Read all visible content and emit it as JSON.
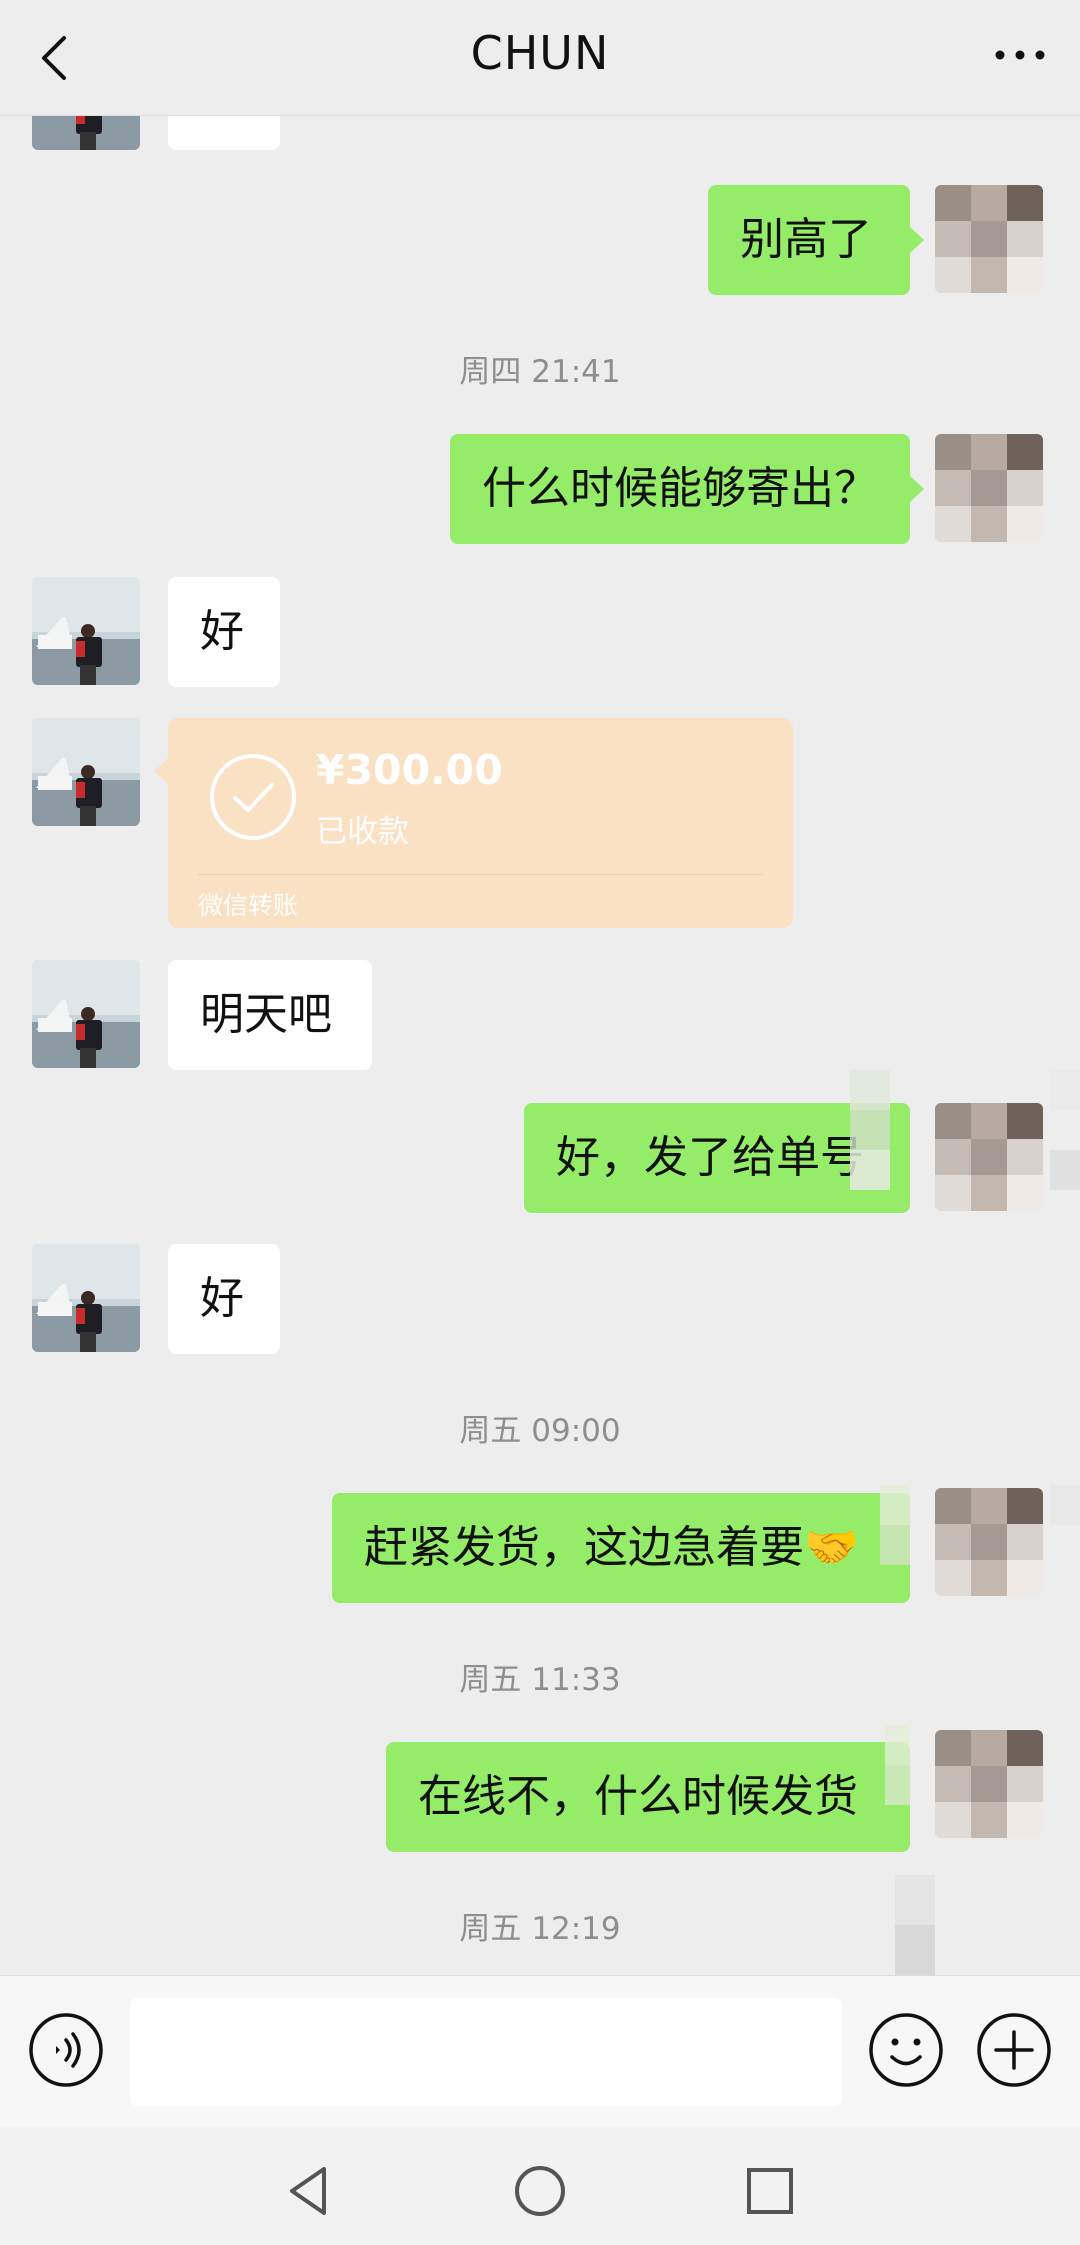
{
  "header": {
    "title": "CHUN",
    "back_icon": "chevron-left-icon",
    "more_icon": "more-dots-icon"
  },
  "messages": {
    "m1": {
      "text": "别高了"
    },
    "t1": "周四 21:41",
    "m2": {
      "text": "什么时候能够寄出？"
    },
    "m3": {
      "text": "好"
    },
    "transfer": {
      "amount": "¥300.00",
      "status": "已收款",
      "footer": "微信转账"
    },
    "m4": {
      "text": "明天吧"
    },
    "m5": {
      "text": "好，发了给单号"
    },
    "m6": {
      "text": "好"
    },
    "t2": "周五 09:00",
    "m7": {
      "text": "赶紧发货，这边急着要🤝"
    },
    "t3": "周五 11:33",
    "m8": {
      "text": "在线不，什么时候发货"
    },
    "t4": "周五 12:19"
  },
  "input_bar": {
    "voice_icon": "voice-icon",
    "emoji_icon": "emoji-icon",
    "plus_icon": "plus-icon"
  },
  "colors": {
    "background": "#ededed",
    "outgoing_bubble": "#95ec69",
    "incoming_bubble": "#ffffff",
    "transfer_card": "#fbe1c4",
    "timestamp": "#8e8e8e"
  }
}
